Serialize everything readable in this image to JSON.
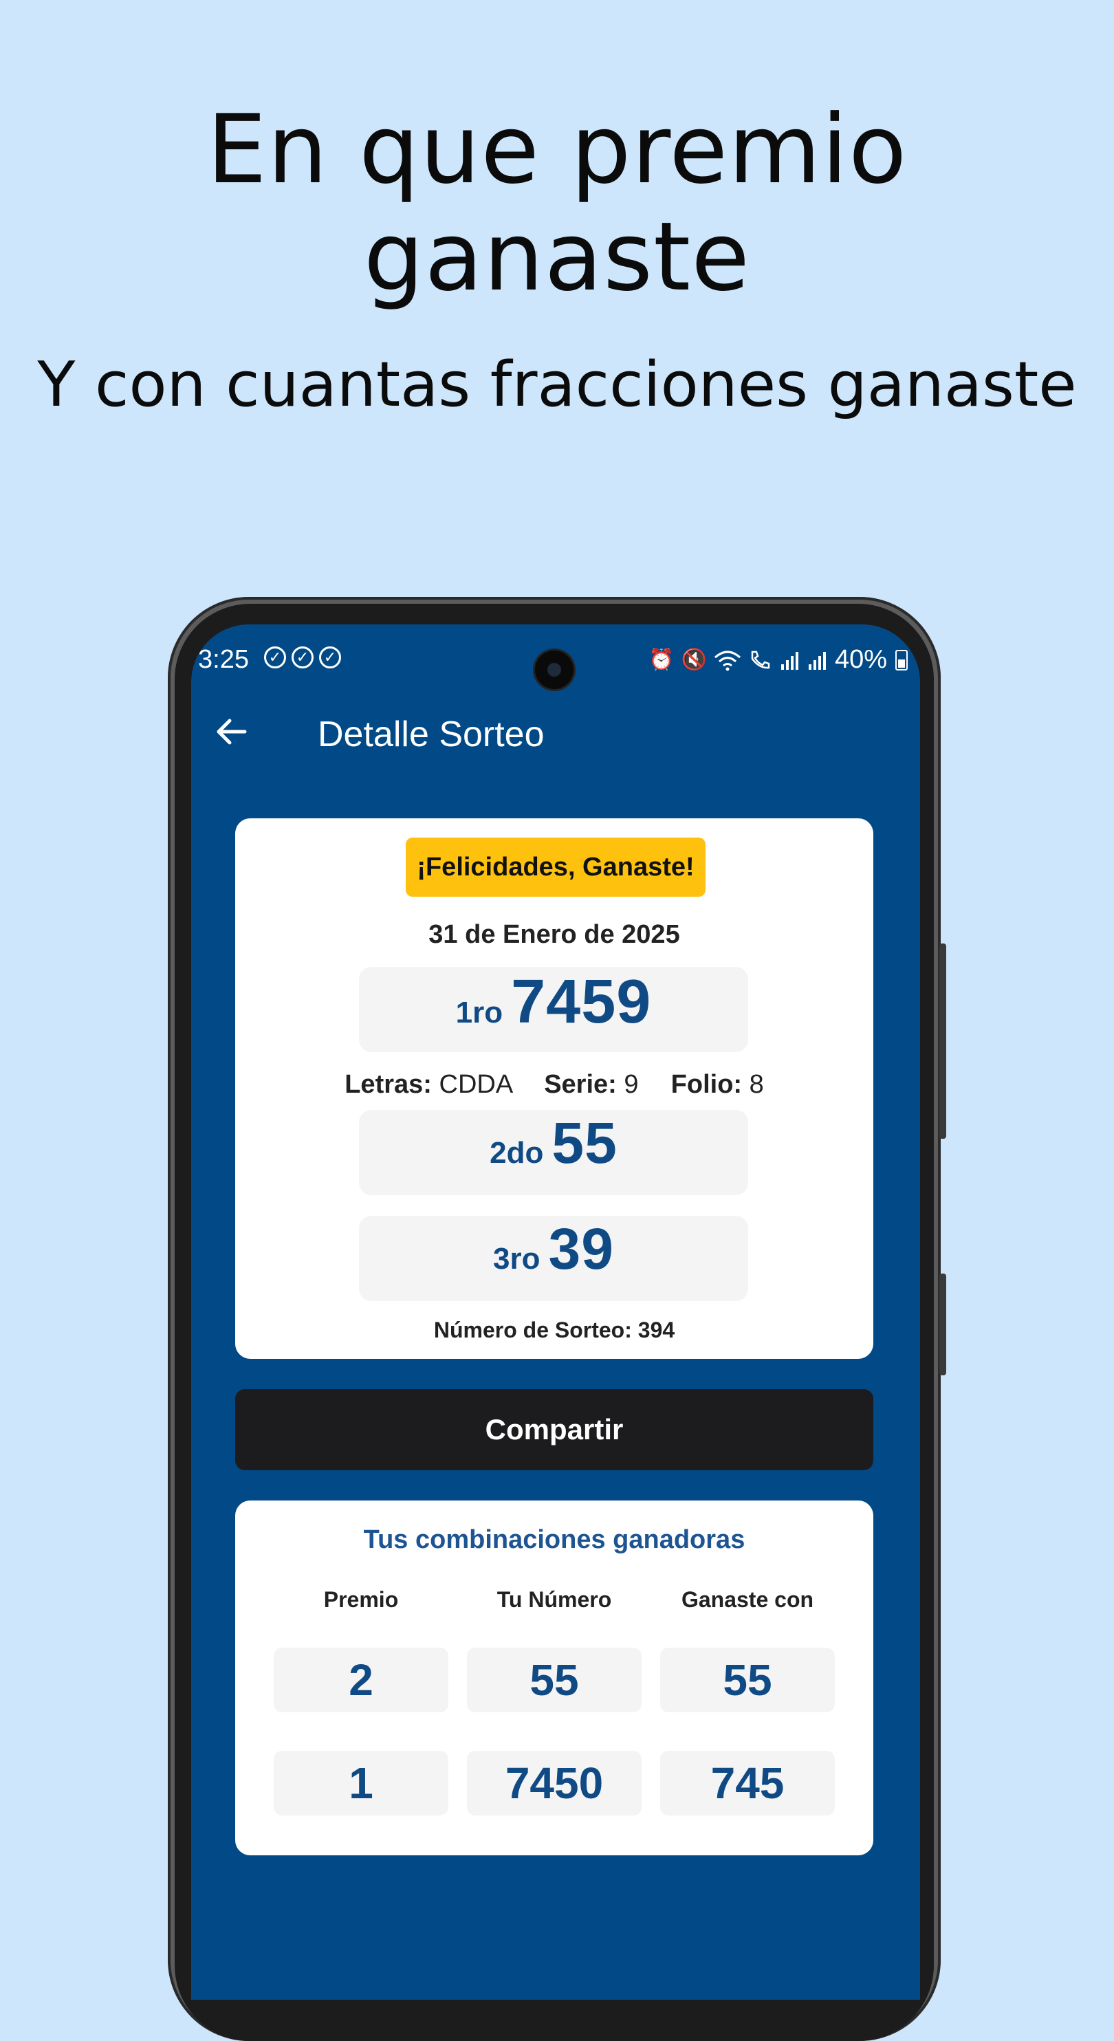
{
  "promo": {
    "headline": "En que premio ganaste",
    "subheadline": "Y con cuantas fracciones ganaste"
  },
  "status_bar": {
    "time": "3:25",
    "battery": "40%",
    "icons": [
      "check-circle-icon",
      "check-circle-icon",
      "check-circle-icon",
      "alarm-icon",
      "mute-icon",
      "wifi-icon",
      "wifi-calling-icon",
      "signal-icon",
      "signal-icon",
      "battery-icon"
    ]
  },
  "app_bar": {
    "back_icon": "arrow-left-icon",
    "title": "Detalle Sorteo"
  },
  "result_card": {
    "badge": "¡Felicidades, Ganaste!",
    "date": "31 de Enero de 2025",
    "prizes": [
      {
        "rank": "1ro",
        "number": "7459"
      },
      {
        "rank": "2do",
        "number": "55"
      },
      {
        "rank": "3ro",
        "number": "39"
      }
    ],
    "letras_label": "Letras:",
    "letras_value": "CDDA",
    "serie_label": "Serie:",
    "serie_value": "9",
    "folio_label": "Folio:",
    "folio_value": "8",
    "draw_number": "Número de Sorteo: 394"
  },
  "share_button": "Compartir",
  "combos": {
    "title": "Tus combinaciones ganadoras",
    "headers": [
      "Premio",
      "Tu Número",
      "Ganaste con"
    ],
    "rows": [
      [
        "2",
        "55",
        "55"
      ],
      [
        "1",
        "7450",
        "745"
      ]
    ]
  },
  "colors": {
    "background": "#cde6fc",
    "app_primary": "#024a87",
    "badge": "#fdc10e",
    "number_text": "#104a85",
    "share_button": "#1c1c1e"
  }
}
